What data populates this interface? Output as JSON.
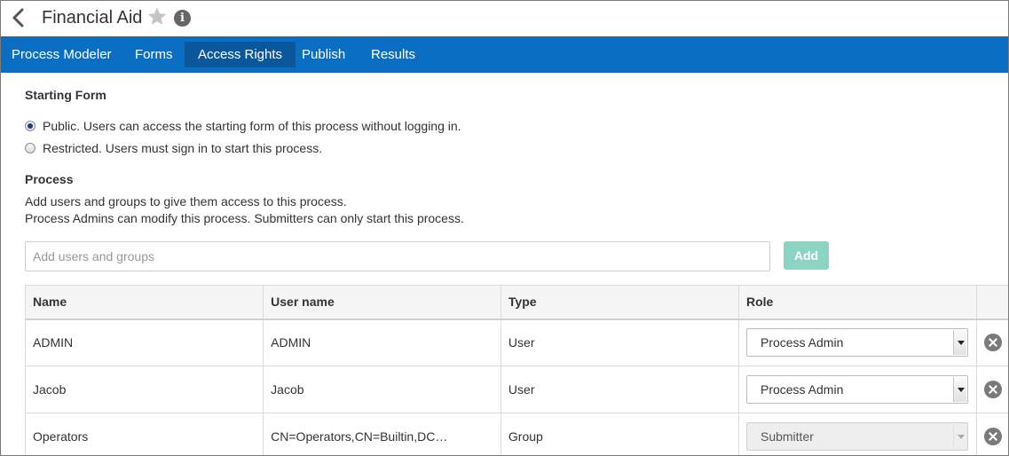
{
  "header": {
    "title": "Financial Aid"
  },
  "nav": {
    "tabs": [
      {
        "label": "Process Modeler"
      },
      {
        "label": "Forms"
      },
      {
        "label": "Access Rights"
      },
      {
        "label": "Publish"
      },
      {
        "label": "Results"
      }
    ],
    "active_tab": "Access Rights"
  },
  "starting_form": {
    "title": "Starting Form",
    "options": [
      {
        "label": "Public. Users can access the starting form of this process without logging in.",
        "selected": true
      },
      {
        "label": "Restricted. Users must sign in to start this process.",
        "selected": false
      }
    ]
  },
  "process": {
    "title": "Process",
    "description_line1": "Add users and groups to give them access to this process.",
    "description_line2": "Process Admins can modify this process. Submitters can only start this process.",
    "search_placeholder": "Add users and groups",
    "search_value": "",
    "add_label": "Add"
  },
  "table": {
    "columns": [
      "Name",
      "User name",
      "Type",
      "Role"
    ],
    "rows": [
      {
        "name": "ADMIN",
        "username": "ADMIN",
        "type": "User",
        "role": "Process Admin",
        "role_disabled": false
      },
      {
        "name": "Jacob",
        "username": "Jacob",
        "type": "User",
        "role": "Process Admin",
        "role_disabled": false
      },
      {
        "name": "Operators",
        "username": "CN=Operators,CN=Builtin,DC…",
        "type": "Group",
        "role": "Submitter",
        "role_disabled": true
      }
    ]
  },
  "colors": {
    "nav_bg": "#0a6fc2",
    "nav_active": "#0a579b",
    "add_button": "#8dd3c3"
  }
}
